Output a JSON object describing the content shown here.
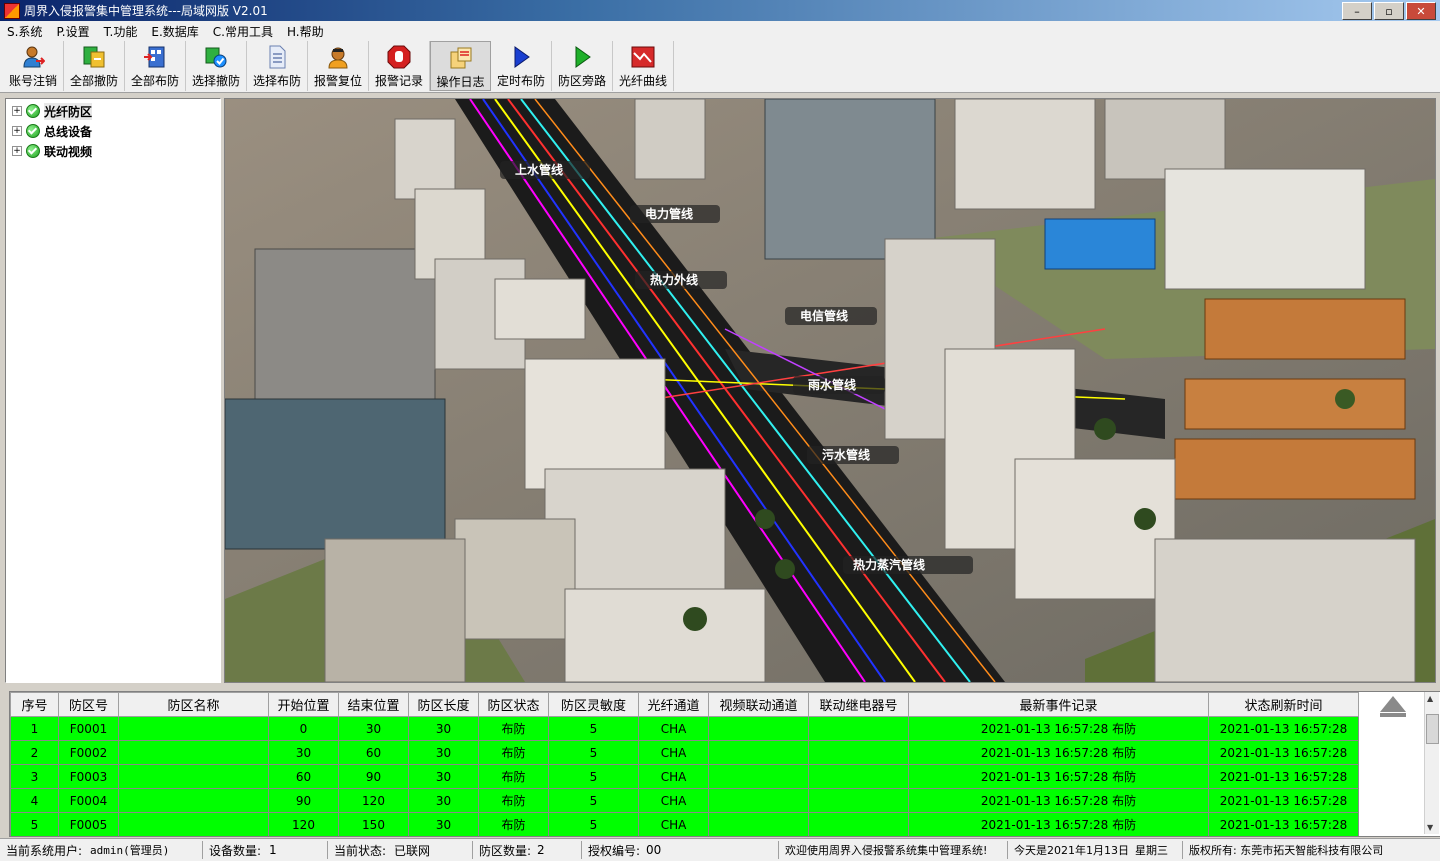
{
  "window": {
    "title": "周界入侵报警集中管理系统---局域网版 V2.01",
    "minimize": "–",
    "maximize": "▫",
    "close": "✕"
  },
  "menu": [
    "S.系统",
    "P.设置",
    "T.功能",
    "E.数据库",
    "C.常用工具",
    "H.帮助"
  ],
  "toolbar": [
    {
      "label": "账号注销",
      "icon": "user-logout-icon"
    },
    {
      "label": "全部撤防",
      "icon": "disarm-all-icon"
    },
    {
      "label": "全部布防",
      "icon": "arm-all-icon"
    },
    {
      "label": "选择撤防",
      "icon": "select-disarm-icon"
    },
    {
      "label": "选择布防",
      "icon": "select-arm-icon"
    },
    {
      "label": "报警复位",
      "icon": "alarm-reset-icon"
    },
    {
      "label": "报警记录",
      "icon": "alarm-record-icon"
    },
    {
      "label": "操作日志",
      "icon": "operation-log-icon"
    },
    {
      "label": "定时布防",
      "icon": "timed-arm-icon"
    },
    {
      "label": "防区旁路",
      "icon": "zone-bypass-icon"
    },
    {
      "label": "光纤曲线",
      "icon": "fiber-curve-icon"
    }
  ],
  "tree": [
    {
      "label": "光纤防区",
      "expander": "+"
    },
    {
      "label": "总线设备",
      "expander": "+"
    },
    {
      "label": "联动视频",
      "expander": "+"
    }
  ],
  "map": {
    "labels": [
      "上水管线",
      "电力管线",
      "热力外线",
      "电信管线",
      "雨水管线",
      "污水管线",
      "热力蒸汽管线"
    ]
  },
  "table": {
    "headers": [
      "序号",
      "防区号",
      "防区名称",
      "开始位置",
      "结束位置",
      "防区长度",
      "防区状态",
      "防区灵敏度",
      "光纤通道",
      "视频联动通道",
      "联动继电器号",
      "最新事件记录",
      "状态刷新时间"
    ],
    "rows": [
      [
        "1",
        "F0001",
        "",
        "0",
        "30",
        "30",
        "布防",
        "5",
        "CHA",
        "",
        "",
        "2021-01-13 16:57:28 布防",
        "2021-01-13 16:57:28"
      ],
      [
        "2",
        "F0002",
        "",
        "30",
        "60",
        "30",
        "布防",
        "5",
        "CHA",
        "",
        "",
        "2021-01-13 16:57:28 布防",
        "2021-01-13 16:57:28"
      ],
      [
        "3",
        "F0003",
        "",
        "60",
        "90",
        "30",
        "布防",
        "5",
        "CHA",
        "",
        "",
        "2021-01-13 16:57:28 布防",
        "2021-01-13 16:57:28"
      ],
      [
        "4",
        "F0004",
        "",
        "90",
        "120",
        "30",
        "布防",
        "5",
        "CHA",
        "",
        "",
        "2021-01-13 16:57:28 布防",
        "2021-01-13 16:57:28"
      ],
      [
        "5",
        "F0005",
        "",
        "120",
        "150",
        "30",
        "布防",
        "5",
        "CHA",
        "",
        "",
        "2021-01-13 16:57:28 布防",
        "2021-01-13 16:57:28"
      ]
    ],
    "row_color": "#00ff00"
  },
  "status": {
    "user_label": "当前系统用户:",
    "user_value": "admin(管理员)",
    "devices_label": "设备数量:",
    "devices_value": "1",
    "state_label": "当前状态:",
    "state_value": "已联网",
    "zones_label": "防区数量:",
    "zones_value": "2",
    "auth_label": "授权编号:",
    "auth_value": "00",
    "welcome": "欢迎使用周界入侵报警系统集中管理系统!",
    "today": "今天是2021年1月13日",
    "weekday": "星期三",
    "copyright": "版权所有: 东莞市拓天智能科技有限公司"
  }
}
